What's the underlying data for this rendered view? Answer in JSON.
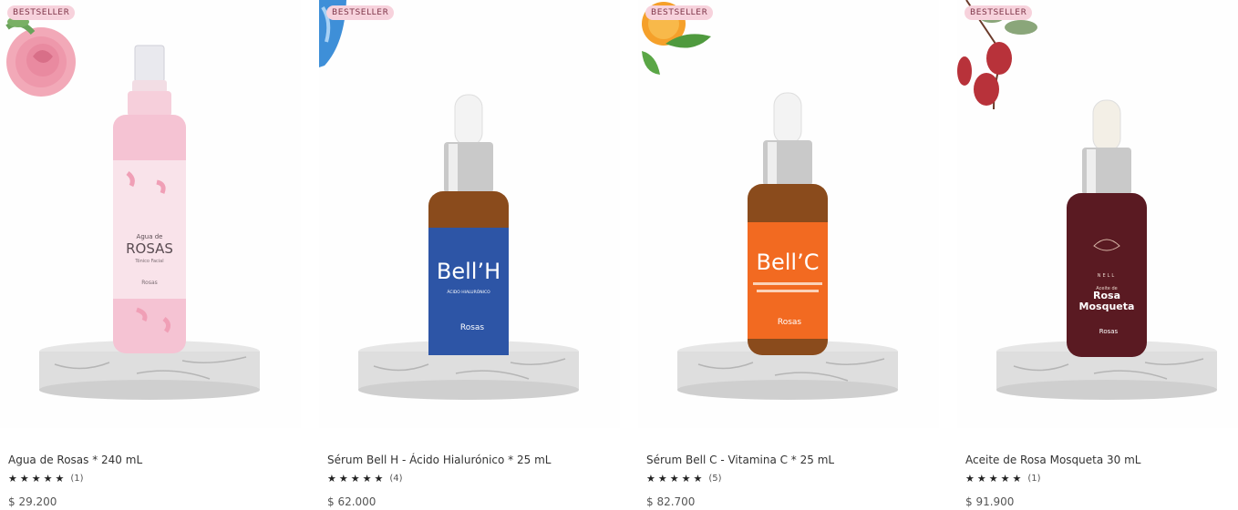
{
  "products": [
    {
      "badge": "BESTSELLER",
      "name": "Agua de Rosas * 240 mL",
      "rating_count": "(1)",
      "price": "$ 29.200",
      "stars": 5,
      "label_line1": "Agua de",
      "label_line2": "ROSAS",
      "label_line3": "Tónico Facial",
      "brand": "Rosas",
      "accent": "#f2a7c0"
    },
    {
      "badge": "BESTSELLER",
      "name": "Sérum Bell H - Ácido Hialurónico * 25 mL",
      "rating_count": "(4)",
      "price": "$ 62.000",
      "stars": 5,
      "label_line1": "Bell’H",
      "label_line2": "ÁCIDO HIALURÓNICO",
      "brand": "Rosas",
      "accent": "#2d55a6"
    },
    {
      "badge": "BESTSELLER",
      "name": "Sérum Bell C - Vitamina C * 25 mL",
      "rating_count": "(5)",
      "price": "$ 82.700",
      "stars": 5,
      "label_line1": "Bell’C",
      "brand": "Rosas",
      "accent": "#f26a21"
    },
    {
      "badge": "BESTSELLER",
      "name": "Aceite de Rosa Mosqueta 30 mL",
      "rating_count": "(1)",
      "price": "$ 91.900",
      "stars": 5,
      "label_line1": "NELL",
      "label_line2": "Aceite de",
      "label_line3": "Rosa",
      "label_line4": "Mosqueta",
      "brand": "Rosas",
      "accent": "#5a1a22"
    }
  ],
  "star_glyph": "★"
}
